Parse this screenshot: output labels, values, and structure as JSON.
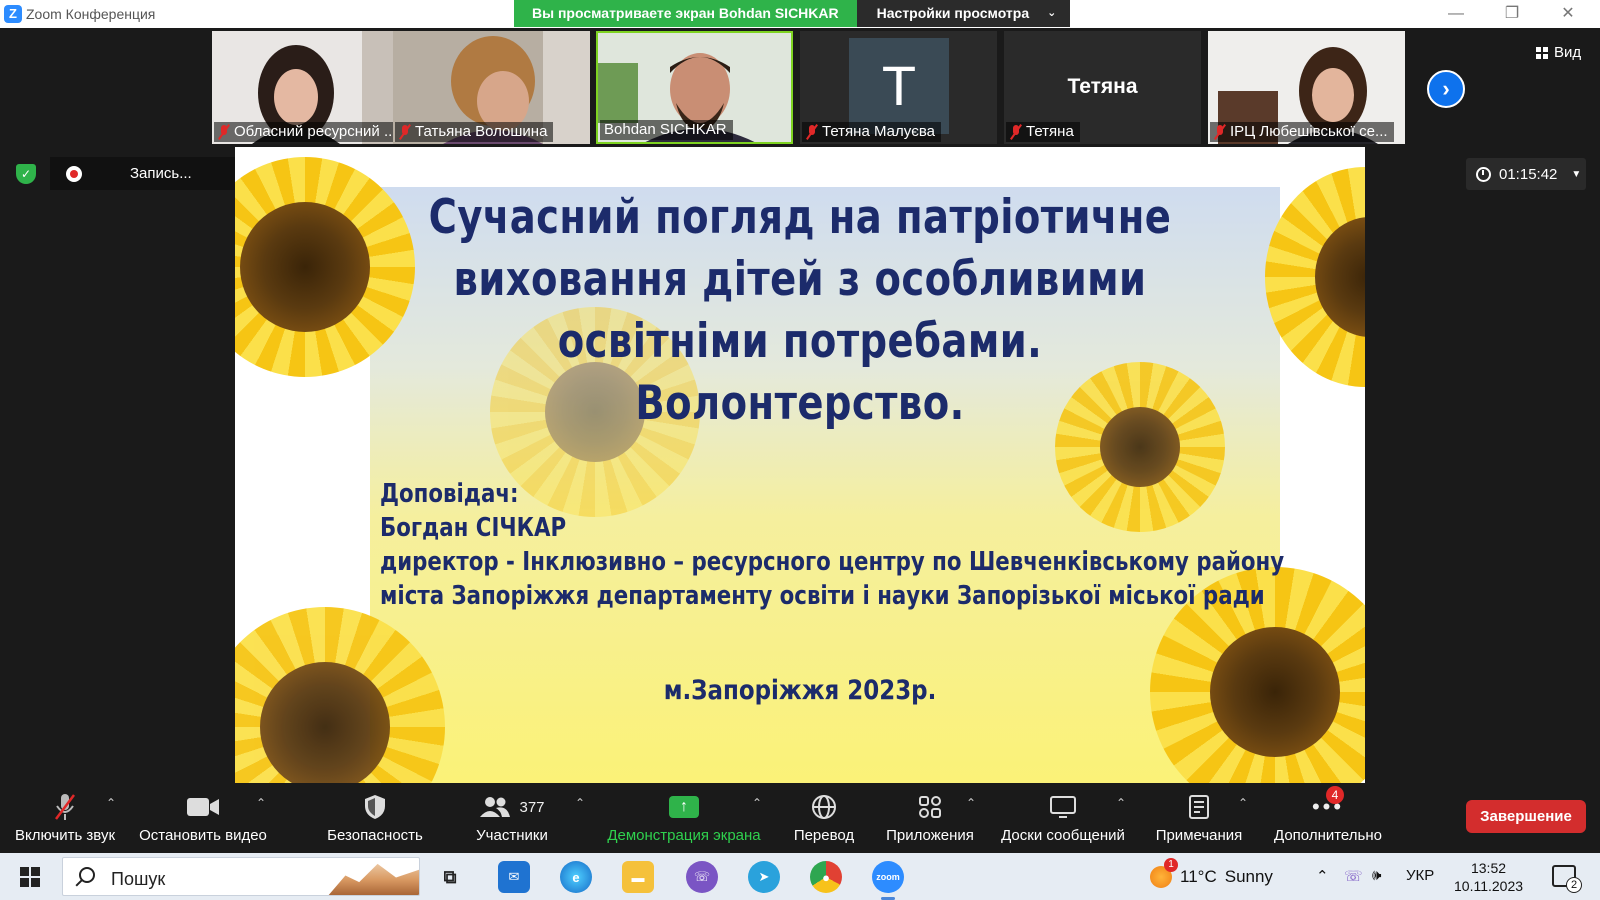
{
  "window": {
    "title": "Zoom Конференция"
  },
  "share_banner": {
    "viewing_text": "Вы просматриваете экран Bohdan SICHKAR",
    "view_settings_label": "Настройки просмотра"
  },
  "gallery": {
    "tiles": [
      {
        "name": "Обласний ресурсний ...",
        "muted": true,
        "type": "video"
      },
      {
        "name": "Татьяна Волошина",
        "muted": true,
        "type": "video"
      },
      {
        "name": "Bohdan SICHKAR",
        "muted": false,
        "type": "video",
        "active_speaker": true
      },
      {
        "name": "Тетяна Малуєва",
        "muted": true,
        "type": "avatar",
        "avatar_letter": "T"
      },
      {
        "name": "Тетяна",
        "muted": true,
        "type": "name",
        "display_name": "Тетяна"
      },
      {
        "name": "ІРЦ Любешівської се...",
        "muted": true,
        "type": "video"
      }
    ],
    "view_label": "Вид"
  },
  "recording": {
    "label": "Запись...",
    "pause_icon": "pause-icon",
    "stop_icon": "stop-icon"
  },
  "meeting_timer": "01:15:42",
  "slide": {
    "title_lines": [
      "Сучасний погляд на патріотичне",
      "виховання дітей з особливими",
      "освітніми потребами. Волонтерство."
    ],
    "speaker_lines": [
      "Доповідач:",
      "Богдан СІЧКАР",
      "директор - Інклюзивно – ресурсного центру по Шевченківському району",
      "міста Запоріжжя департаменту освіти і науки Запорізької міської ради"
    ],
    "place": "м.Запоріжжя 2023р."
  },
  "toolbar": {
    "unmute": "Включить звук",
    "stop_video": "Остановить видео",
    "security": "Безопасность",
    "participants": "Участники",
    "participants_count": "377",
    "share_screen": "Демонстрация экрана",
    "translation": "Перевод",
    "apps": "Приложения",
    "whiteboards": "Доски сообщений",
    "notes": "Примечания",
    "more": "Дополнительно",
    "more_badge": "4",
    "end": "Завершение"
  },
  "taskbar": {
    "search_placeholder": "Пошук",
    "weather_temp": "11°C",
    "weather_desc": "Sunny",
    "weather_badge": "1",
    "language": "УКР",
    "time": "13:52",
    "date": "10.11.2023",
    "notifications_count": "2"
  },
  "colors": {
    "zoom_blue": "#2d8cff",
    "share_green": "#2fb34a",
    "end_red": "#d32d2d",
    "slide_text": "#1c2b6b"
  }
}
